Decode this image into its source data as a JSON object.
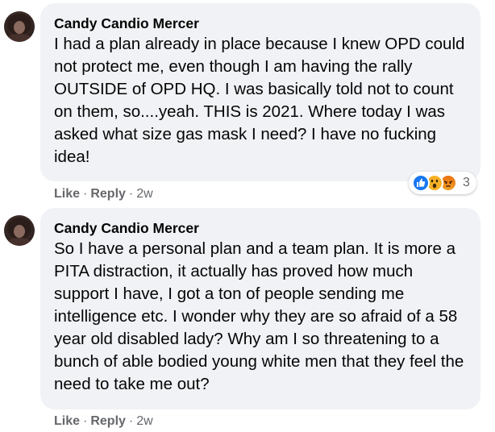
{
  "comments": [
    {
      "author": "Candy Candio Mercer",
      "text": "I had a plan already in place because I knew OPD could not protect me, even though I am having the rally OUTSIDE of OPD HQ. I was basically told not to count on them, so....yeah. THIS is 2021. Where today I was asked what size gas mask I need? I have no fucking idea!",
      "like_label": "Like",
      "reply_label": "Reply",
      "time": "2w",
      "reactions": {
        "icons": [
          "like-icon",
          "wow-icon",
          "angry-icon"
        ],
        "count": "3"
      }
    },
    {
      "author": "Candy Candio Mercer",
      "text": "So I have a personal plan and a team plan. It is more a PITA distraction, it actually has proved how much support I have, I got a ton of people sending me intelligence etc. I wonder why they are so afraid of a 58 year old disabled lady? Why am I so threatening to a bunch of able bodied young white men that they feel the need to take me out?",
      "like_label": "Like",
      "reply_label": "Reply",
      "time": "2w"
    }
  ],
  "separator": "·",
  "colors": {
    "bubble_bg": "#f0f2f5",
    "meta_text": "#65676b",
    "like_blue": "#1877f2",
    "wow_yellow": "#f7b125",
    "angry_orange": "#e9710f"
  }
}
